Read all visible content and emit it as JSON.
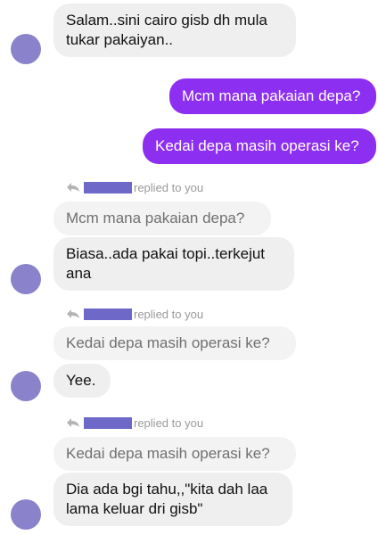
{
  "colors": {
    "incoming_bubble": "#efefef",
    "quoted_bubble": "#f3f3f3",
    "outgoing_bubble": "#8d2ff0",
    "avatar": "#8a83cc",
    "redaction": "#6e68c8"
  },
  "messages": {
    "m1": {
      "text": "Salam..sini cairo gisb dh mula tukar pakaiyan.."
    },
    "m2": {
      "text": "Mcm mana pakaian depa?"
    },
    "m3": {
      "text": "Kedai depa masih operasi ke?"
    },
    "r1": {
      "replied_label": "replied to you",
      "quoted": "Mcm mana pakaian depa?",
      "text": "Biasa..ada pakai topi..terkejut ana"
    },
    "r2": {
      "replied_label": "replied to you",
      "quoted": "Kedai depa masih operasi ke?",
      "text": "Yee."
    },
    "r3": {
      "replied_label": "replied to you",
      "quoted": "Kedai depa masih operasi ke?",
      "text": "Dia ada bgi tahu,,\"kita dah laa lama keluar dri gisb\""
    }
  }
}
